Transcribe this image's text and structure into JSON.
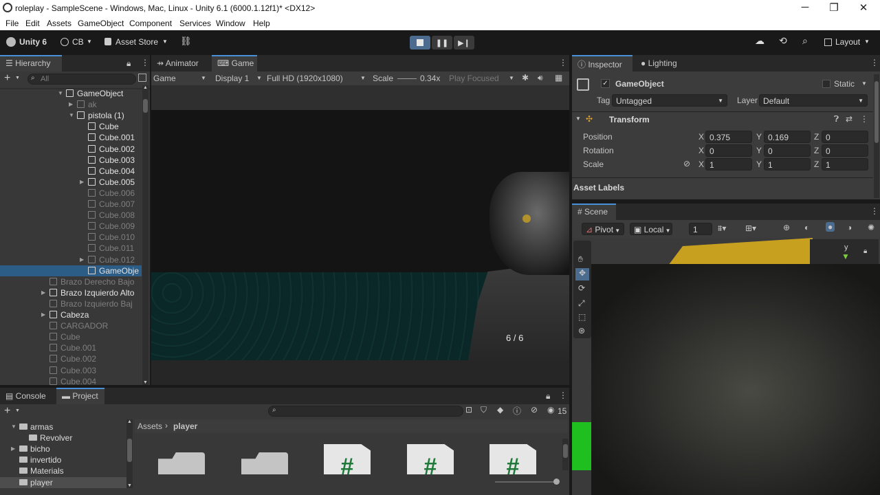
{
  "window": {
    "title": "roleplay - SampleScene - Windows, Mac, Linux - Unity 6.1 (6000.1.12f1)* <DX12>",
    "min": "─",
    "max": "❐",
    "close": "✕"
  },
  "menu": [
    "File",
    "Edit",
    "Assets",
    "GameObject",
    "Component",
    "Services",
    "Window",
    "Help"
  ],
  "toolbar": {
    "unity": "Unity 6",
    "account": "CB",
    "asset_store": "Asset Store",
    "layout": "Layout"
  },
  "hierarchy": {
    "tab": "Hierarchy",
    "search_placeholder": "All",
    "rows": [
      {
        "label": "GameObject",
        "indent": 0,
        "arrow": "▼",
        "style": "bright"
      },
      {
        "label": "ak",
        "indent": 1,
        "arrow": "▶",
        "style": "dim"
      },
      {
        "label": "pistola (1)",
        "indent": 1,
        "arrow": "▼",
        "style": "bright"
      },
      {
        "label": "Cube",
        "indent": 2,
        "arrow": "",
        "style": "bright"
      },
      {
        "label": "Cube.001",
        "indent": 2,
        "arrow": "",
        "style": "bright"
      },
      {
        "label": "Cube.002",
        "indent": 2,
        "arrow": "",
        "style": "bright"
      },
      {
        "label": "Cube.003",
        "indent": 2,
        "arrow": "",
        "style": "bright"
      },
      {
        "label": "Cube.004",
        "indent": 2,
        "arrow": "",
        "style": "bright"
      },
      {
        "label": "Cube.005",
        "indent": 2,
        "arrow": "▶",
        "style": "bright"
      },
      {
        "label": "Cube.006",
        "indent": 2,
        "arrow": "",
        "style": "dim"
      },
      {
        "label": "Cube.007",
        "indent": 2,
        "arrow": "",
        "style": "dim"
      },
      {
        "label": "Cube.008",
        "indent": 2,
        "arrow": "",
        "style": "dim"
      },
      {
        "label": "Cube.009",
        "indent": 2,
        "arrow": "",
        "style": "dim"
      },
      {
        "label": "Cube.010",
        "indent": 2,
        "arrow": "",
        "style": "dim"
      },
      {
        "label": "Cube.011",
        "indent": 2,
        "arrow": "",
        "style": "dim"
      },
      {
        "label": "Cube.012",
        "indent": 2,
        "arrow": "▶",
        "style": "dim"
      },
      {
        "label": "GameObje",
        "indent": 2,
        "arrow": "",
        "style": "selected"
      },
      {
        "label": "Brazo Derecho Bajo",
        "indent": -1,
        "arrow": "",
        "style": "dim"
      },
      {
        "label": "Brazo Izquierdo Alto",
        "indent": -1,
        "arrow": "▶",
        "style": "bright"
      },
      {
        "label": "Brazo Izquierdo Baj",
        "indent": -1,
        "arrow": "",
        "style": "dim"
      },
      {
        "label": "Cabeza",
        "indent": -1,
        "arrow": "▶",
        "style": "bright"
      },
      {
        "label": "CARGADOR",
        "indent": -1,
        "arrow": "",
        "style": "dim"
      },
      {
        "label": "Cube",
        "indent": -1,
        "arrow": "",
        "style": "dim"
      },
      {
        "label": "Cube.001",
        "indent": -1,
        "arrow": "",
        "style": "dim"
      },
      {
        "label": "Cube.002",
        "indent": -1,
        "arrow": "",
        "style": "dim"
      },
      {
        "label": "Cube.003",
        "indent": -1,
        "arrow": "",
        "style": "dim"
      },
      {
        "label": "Cube.004",
        "indent": -1,
        "arrow": "",
        "style": "dim"
      }
    ]
  },
  "center_tabs": {
    "animator": "Animator",
    "game": "Game"
  },
  "game_bar": {
    "view": "Game",
    "display": "Display 1",
    "resolution": "Full HD (1920x1080)",
    "scale_label": "Scale",
    "scale_value": "0.34x",
    "play_mode": "Play Focused"
  },
  "game_view": {
    "ammo": "6 / 6"
  },
  "inspector": {
    "tab_inspector": "Inspector",
    "tab_lighting": "Lighting",
    "object_name": "GameObject",
    "static": "Static",
    "tag_label": "Tag",
    "tag_value": "Untagged",
    "layer_label": "Layer",
    "layer_value": "Default",
    "transform": "Transform",
    "position": {
      "label": "Position",
      "x": "0.375",
      "y": "0.169",
      "z": "0"
    },
    "rotation": {
      "label": "Rotation",
      "x": "0",
      "y": "0",
      "z": "0"
    },
    "scale": {
      "label": "Scale",
      "x": "1",
      "y": "1",
      "z": "1"
    },
    "axes": {
      "x": "X",
      "y": "Y",
      "z": "Z"
    },
    "asset_labels": "Asset Labels"
  },
  "scene": {
    "tab": "Scene",
    "pivot": "Pivot",
    "local": "Local",
    "snap": "1",
    "gizmo_axis": "y"
  },
  "bottom": {
    "tab_console": "Console",
    "tab_project": "Project",
    "count": "15",
    "breadcrumb_root": "Assets",
    "breadcrumb_sep": "›",
    "breadcrumb_current": "player",
    "tree": [
      {
        "label": "armas",
        "indent": 0,
        "arrow": "▼"
      },
      {
        "label": "Revolver",
        "indent": 1,
        "arrow": ""
      },
      {
        "label": "bicho",
        "indent": 0,
        "arrow": "▶"
      },
      {
        "label": "invertido",
        "indent": 0,
        "arrow": ""
      },
      {
        "label": "Materials",
        "indent": 0,
        "arrow": ""
      },
      {
        "label": "player",
        "indent": 0,
        "arrow": "",
        "selected": true
      }
    ],
    "script_symbol": "#"
  },
  "colors": {
    "accent": "#4a90d9",
    "selected_row": "#2c5d87",
    "script_green": "#1f7a3a",
    "floor_teal": "#0f5a57",
    "yellow": "#c8a020"
  }
}
